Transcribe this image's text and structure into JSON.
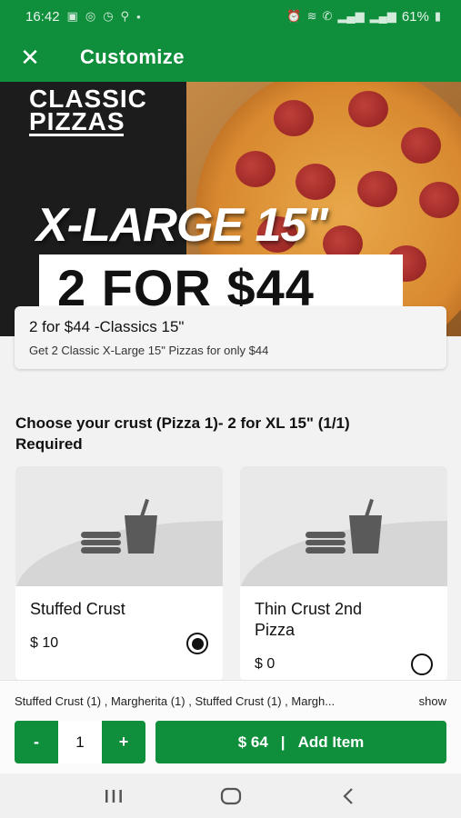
{
  "status_bar": {
    "time": "16:42",
    "battery": "61%",
    "left_icons": [
      "image-icon",
      "whatsapp-icon",
      "clock-icon",
      "location-icon",
      "dot-icon"
    ],
    "right_icons": [
      "alarm-icon",
      "wifi-icon",
      "call-icon",
      "signal-icon",
      "signal-icon",
      "battery-icon"
    ]
  },
  "app_bar": {
    "close_icon": "close-icon",
    "title": "Customize"
  },
  "banner": {
    "logo_line1": "CLASSIC",
    "logo_line2": "PIZZAS",
    "size_text": "X-LARGE 15\"",
    "promo_text": "2 FOR $44"
  },
  "offer": {
    "title": "2 for $44 -Classics 15\"",
    "description": "Get 2 Classic X-Large 15\" Pizzas for only $44"
  },
  "crust_section": {
    "heading": "Choose your crust (Pizza 1)- 2 for XL 15\" (1/1)",
    "requirement": "Required",
    "options": [
      {
        "name": "Stuffed Crust",
        "price": "$ 10",
        "selected": true,
        "image_icon": "burger-drink-icon"
      },
      {
        "name": "Thin Crust 2nd Pizza",
        "price": "$ 0",
        "selected": false,
        "image_icon": "burger-drink-icon"
      }
    ]
  },
  "summary": {
    "text": "Stuffed Crust (1) , Margherita (1) , Stuffed Crust (1) , Margh...",
    "show_label": "show"
  },
  "actions": {
    "minus_label": "-",
    "quantity": "1",
    "plus_label": "+",
    "add_price": "$ 64",
    "add_separator": "|",
    "add_label": "Add Item"
  },
  "nav": {
    "recents_icon": "recents-icon",
    "home_icon": "home-icon",
    "back_icon": "back-icon"
  },
  "colors": {
    "brand_green": "#0f8f3c",
    "background": "#f2f2f2"
  }
}
